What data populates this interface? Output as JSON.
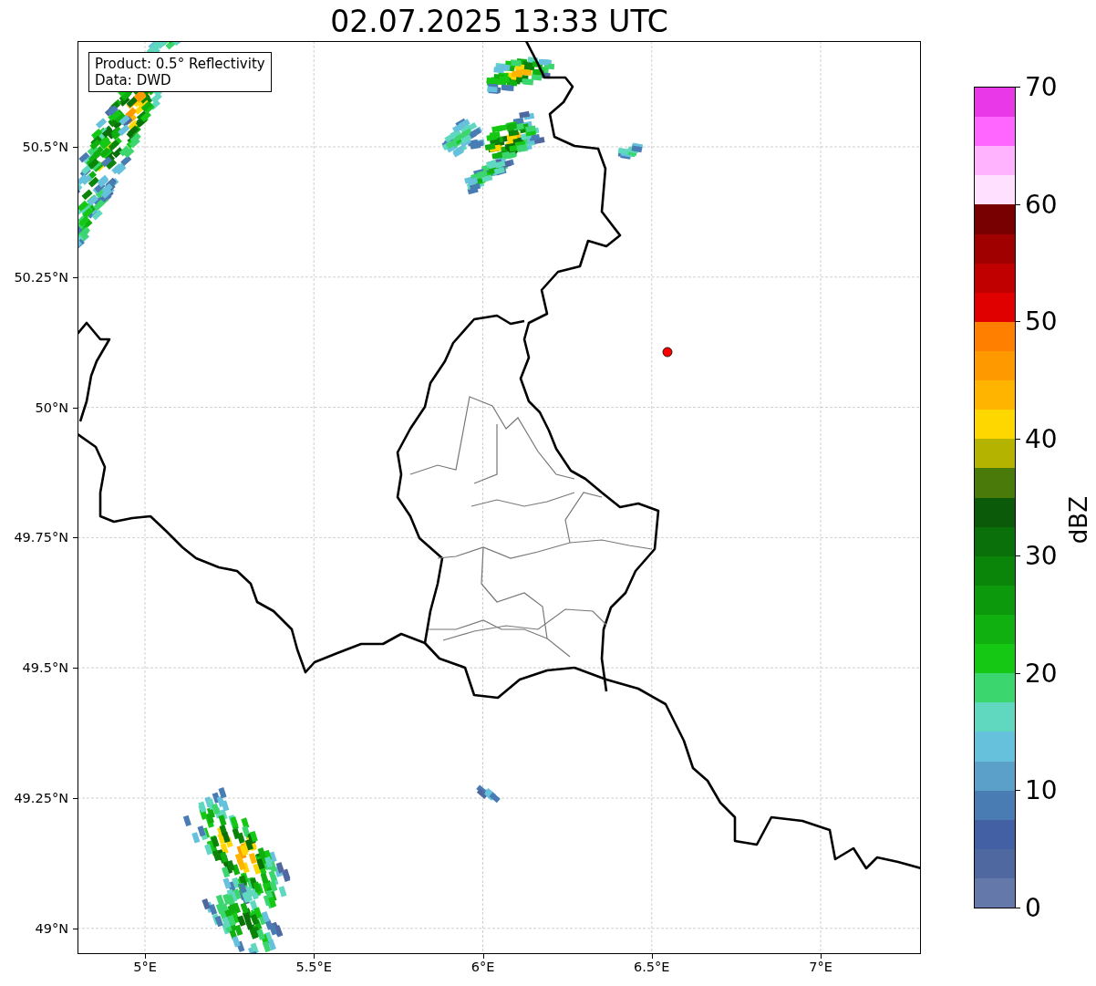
{
  "title": "02.07.2025 13:33 UTC",
  "info_box": {
    "lines": [
      "Product: 0.5° Reflectivity",
      "Data: DWD"
    ]
  },
  "map": {
    "yticks": [
      "50.5°N",
      "50.25°N",
      "50°N",
      "49.75°N",
      "49.5°N",
      "49.25°N",
      "49°N"
    ],
    "xticks": [
      "5°E",
      "5.5°E",
      "6°E",
      "6.5°E",
      "7°E"
    ]
  },
  "colorbar": {
    "label": "dBZ",
    "ticks": [
      "70",
      "60",
      "50",
      "40",
      "30",
      "20",
      "10",
      "0"
    ],
    "bins": [
      {
        "color": "#e838e8"
      },
      {
        "color": "#ff66ff"
      },
      {
        "color": "#ffb3ff"
      },
      {
        "color": "#ffe0ff"
      },
      {
        "color": "#780000"
      },
      {
        "color": "#a00000"
      },
      {
        "color": "#c00000"
      },
      {
        "color": "#e00000"
      },
      {
        "color": "#ff7f00"
      },
      {
        "color": "#ff9900"
      },
      {
        "color": "#ffb400"
      },
      {
        "color": "#ffd700"
      },
      {
        "color": "#b4b400"
      },
      {
        "color": "#4a7a0a"
      },
      {
        "color": "#0a5a0a"
      },
      {
        "color": "#0a700a"
      },
      {
        "color": "#0a850a"
      },
      {
        "color": "#0c9a0c"
      },
      {
        "color": "#10b010"
      },
      {
        "color": "#14c814"
      },
      {
        "color": "#3cd66e"
      },
      {
        "color": "#60d8c0"
      },
      {
        "color": "#66c2dc"
      },
      {
        "color": "#5aa0c8"
      },
      {
        "color": "#4a7cb4"
      },
      {
        "color": "#4460a4"
      },
      {
        "color": "#5068a0"
      },
      {
        "color": "#6478aa"
      }
    ]
  }
}
